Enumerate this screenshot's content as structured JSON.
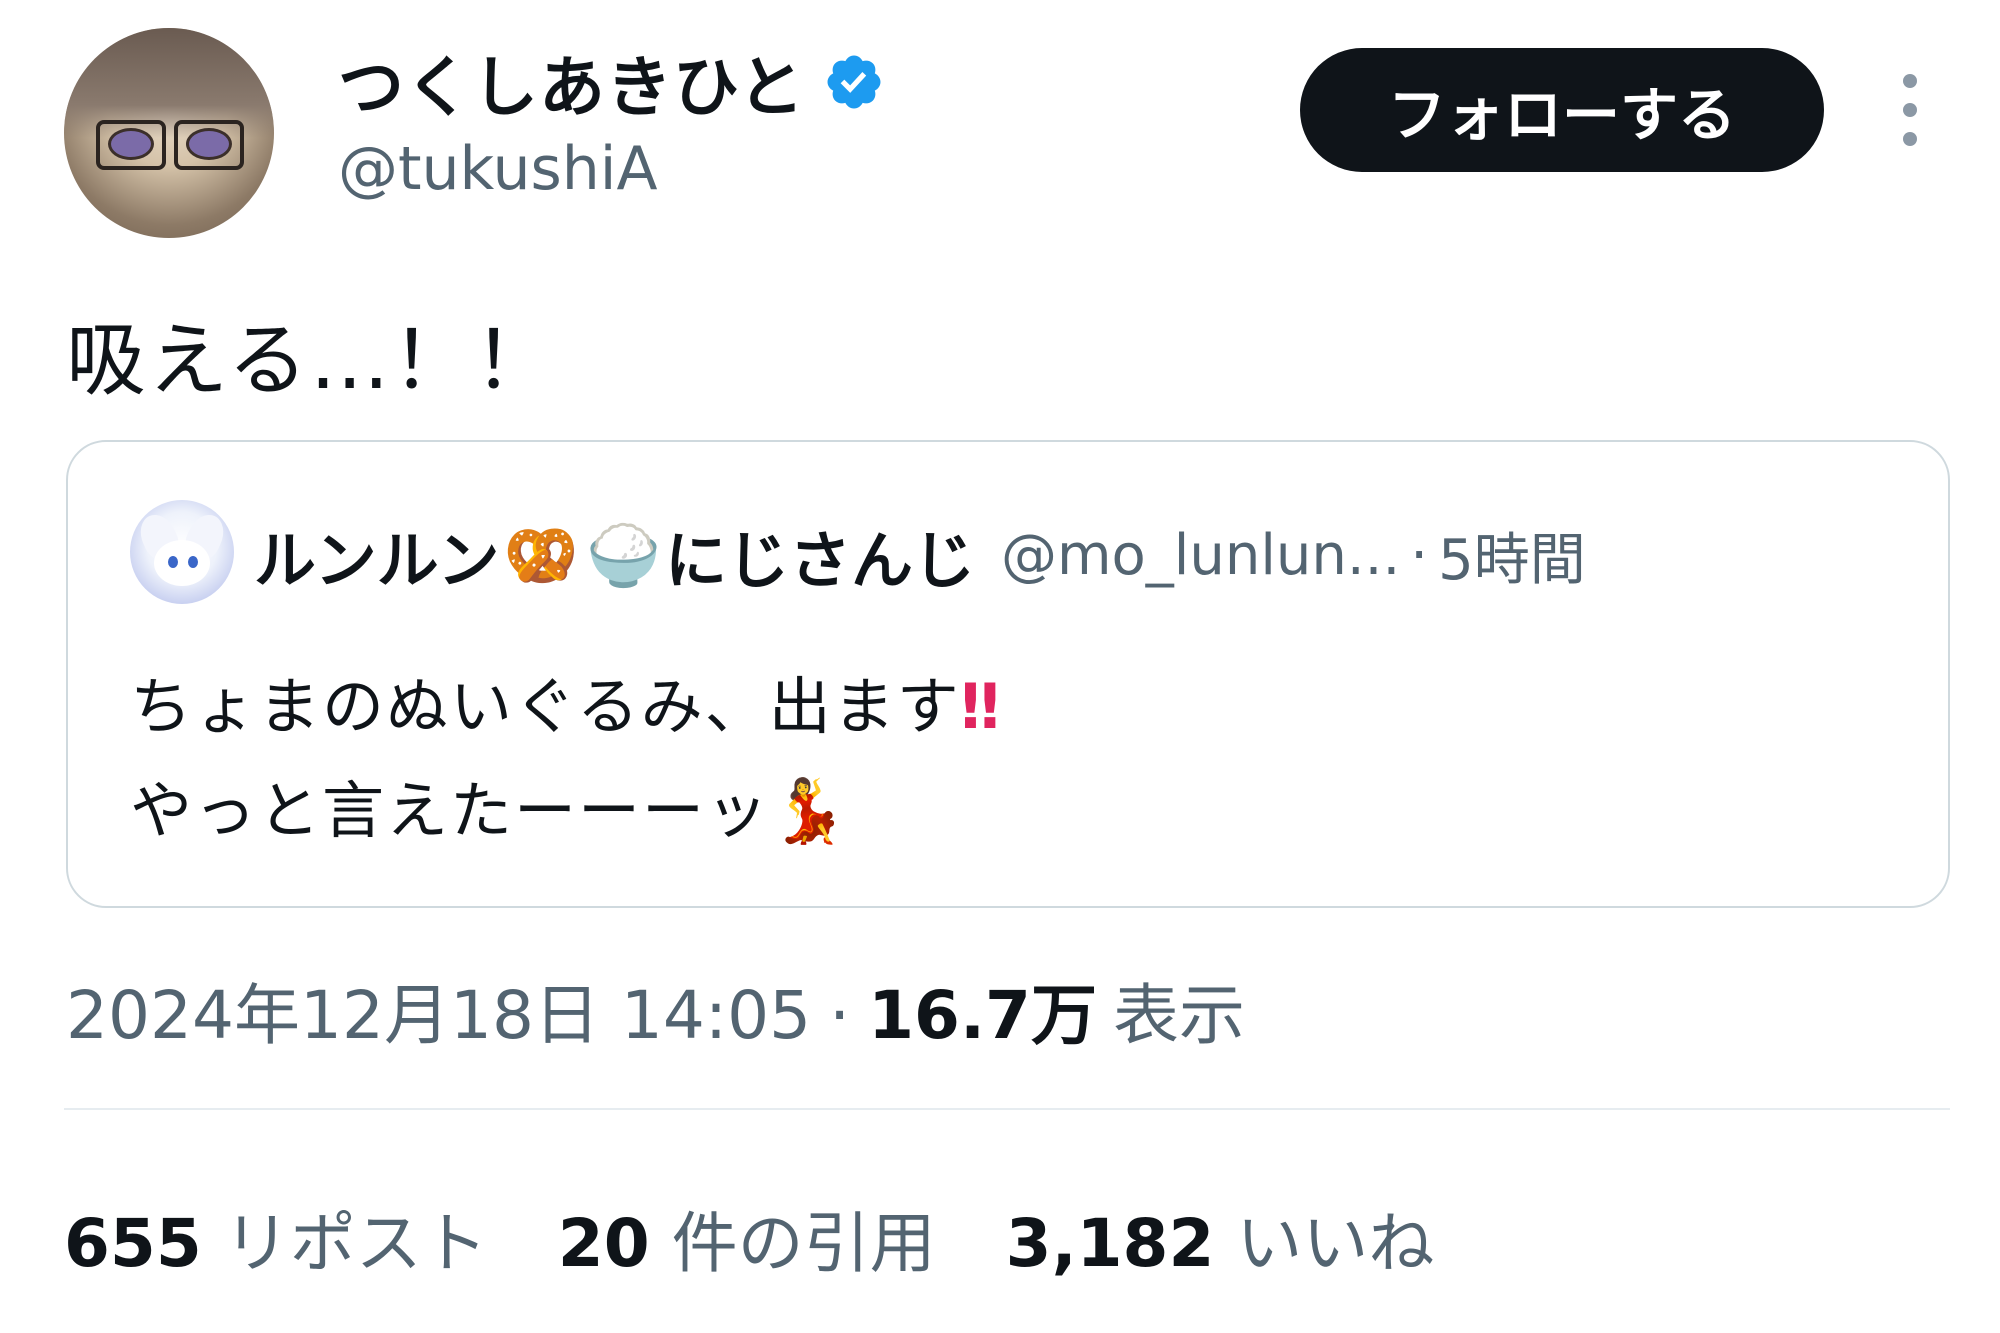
{
  "author": {
    "display_name": "つくしあきひと",
    "handle": "@tukushiA",
    "verified_badge": "verified-badge-icon"
  },
  "actions": {
    "follow_label": "フォローする",
    "more_icon": "more-vertical-icon"
  },
  "tweet": {
    "text": "吸える…！！"
  },
  "quote": {
    "name_part1": "ルンルン",
    "emoji_pretzel": "🥨",
    "emoji_rice": "🍚",
    "name_part2": "にじさんじ",
    "handle": "@mo_lunlun...",
    "dot": "·",
    "time": "5時間",
    "line1_text": "ちょまのぬいぐるみ、出ます",
    "line1_emoji": "‼",
    "line2_text": "やっと言えたーーーッ",
    "line2_emoji": "💃"
  },
  "meta": {
    "datetime": "2024年12月18日 14:05",
    "dot": "·",
    "views": "16.7万",
    "views_label": "表示"
  },
  "stats": {
    "reposts_count": "655",
    "reposts_label": "リポスト",
    "quotes_count": "20",
    "quotes_label": "件の引用",
    "likes_count": "3,182",
    "likes_label": "いいね"
  },
  "colors": {
    "text_primary": "#0f1419",
    "text_secondary": "#536471",
    "verified_blue": "#1d9bf0",
    "button_bg": "#0f1419",
    "border": "#cfd9de"
  }
}
